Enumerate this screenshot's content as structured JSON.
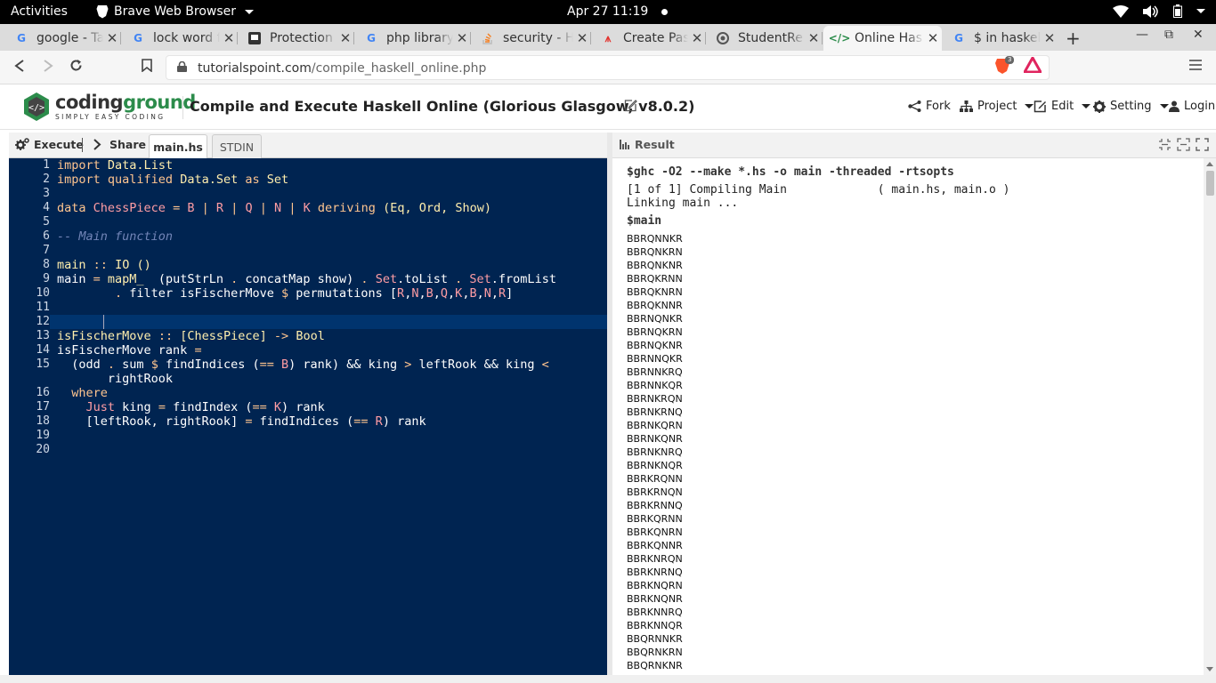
{
  "system": {
    "activities": "Activities",
    "app_name": "Brave Web Browser",
    "clock": "Apr 27  11:19"
  },
  "tabs": [
    {
      "title": "google - Ta",
      "favicon": "google-icon"
    },
    {
      "title": "lock word fi",
      "favicon": "google-icon"
    },
    {
      "title": "Protection a",
      "favicon": "chat-icon"
    },
    {
      "title": "php library",
      "favicon": "google-icon"
    },
    {
      "title": "security - H",
      "favicon": "stackoverflow-icon"
    },
    {
      "title": "Create Pas",
      "favicon": "laravel-icon"
    },
    {
      "title": "StudentRe",
      "favicon": "circle-icon"
    },
    {
      "title": "Online Has",
      "favicon": "code-icon"
    },
    {
      "title": "$ in haskell",
      "favicon": "google-icon"
    }
  ],
  "address": {
    "domain": "tutorialspoint.com",
    "path": "/compile_haskell_online.php",
    "shield_count": "3"
  },
  "header": {
    "logo_primary": "coding",
    "logo_secondary": "ground",
    "logo_tagline": "SIMPLY EASY CODING",
    "title": "Compile and Execute Haskell Online (Glorious Glasgow, v8.0.2)",
    "menu": {
      "fork": "Fork",
      "project": "Project",
      "edit": "Edit",
      "setting": "Setting",
      "login": "Login"
    }
  },
  "editor": {
    "execute": "Execute",
    "share": "Share",
    "tab_file": "main.hs",
    "tab_stdin": "STDIN"
  },
  "result": {
    "label": "Result",
    "command": "$ghc -O2 --make *.hs -o main -threaded -rtsopts",
    "compile_line": "[1 of 1] Compiling Main             ( main.hs, main.o )",
    "link_line": "Linking main ...",
    "run_line": "$main",
    "permutations": [
      "BBRQNNKR",
      "BBRQNKRN",
      "BBRQNKNR",
      "BBRQKRNN",
      "BBRQKNRN",
      "BBRQKNNR",
      "BBRNQNKR",
      "BBRNQKRN",
      "BBRNQKNR",
      "BBRNNQKR",
      "BBRNNKRQ",
      "BBRNNKQR",
      "BBRNKRQN",
      "BBRNKRNQ",
      "BBRNKQRN",
      "BBRNKQNR",
      "BBRNKNRQ",
      "BBRNKNQR",
      "BBRKRQNN",
      "BBRKRNQN",
      "BBRKRNNQ",
      "BBRKQRNN",
      "BBRKQNRN",
      "BBRKQNNR",
      "BBRKNRQN",
      "BBRKNRNQ",
      "BBRKNQRN",
      "BBRKNQNR",
      "BBRKNNRQ",
      "BBRKNNQR",
      "BBQRNNKR",
      "BBQRNKRN",
      "BBQRNKNR"
    ]
  }
}
